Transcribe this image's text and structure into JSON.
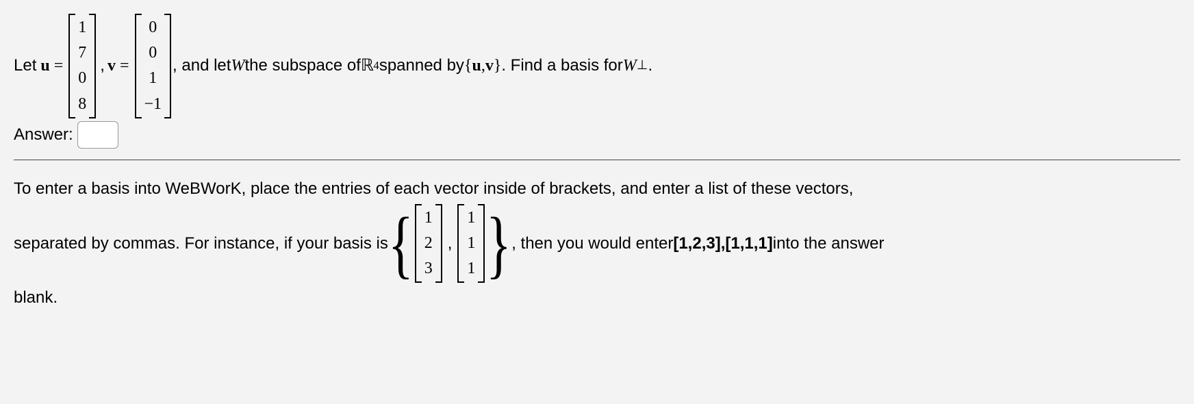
{
  "problem": {
    "intro_let": "Let",
    "u_label": "u",
    "eq": "=",
    "u_vec": [
      "1",
      "7",
      "0",
      "8"
    ],
    "comma": ",",
    "v_label": "v",
    "v_vec": [
      "0",
      "0",
      "1",
      "−1"
    ],
    "text_mid1": ", and let ",
    "W": "W",
    "text_mid2": " the subspace of ",
    "R": "ℝ",
    "R_sup": "4",
    "text_mid3": " spanned by ",
    "set_open": "{",
    "set_u": "u",
    "set_comma": ", ",
    "set_v": "v",
    "set_close": "}",
    "text_mid4": ". Find a basis for ",
    "W2": "W",
    "perp": "⊥",
    "period": "."
  },
  "answer_label": "Answer:",
  "instructions": {
    "line1": "To enter a basis into WeBWorK, place the entries of each vector inside of brackets, and enter a list of these vectors,",
    "line2a": "separated by commas. For instance, if your basis is ",
    "ex_vec1": [
      "1",
      "2",
      "3"
    ],
    "ex_comma": ",",
    "ex_vec2": [
      "1",
      "1",
      "1"
    ],
    "line2b": ", then you would enter ",
    "example_entry": "[1,2,3],[1,1,1]",
    "line2c": " into the answer",
    "line3": "blank."
  }
}
